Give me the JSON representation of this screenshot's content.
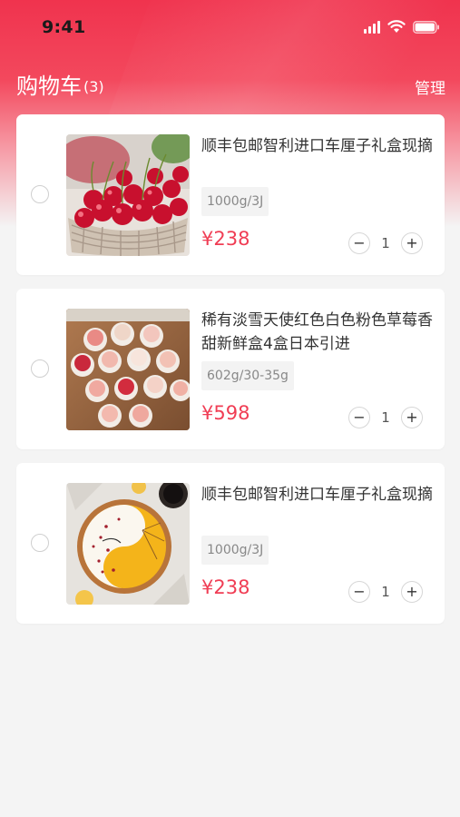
{
  "status_bar": {
    "time": "9:41"
  },
  "header": {
    "title": "购物车",
    "count": "(3)",
    "manage_label": "管理"
  },
  "cart": {
    "items": [
      {
        "name": "顺丰包邮智利进口车厘子礼盒现摘",
        "spec": "1000g/3J",
        "price": "¥238",
        "quantity": "1",
        "image": "cherries-image",
        "selected": false
      },
      {
        "name": "稀有淡雪天使红色白色粉色草莓香甜新鲜盒4盒日本引进",
        "spec": "602g/30-35g",
        "price": "¥598",
        "quantity": "1",
        "image": "strawberries-image",
        "selected": false
      },
      {
        "name": "顺丰包邮智利进口车厘子礼盒现摘",
        "spec": "1000g/3J",
        "price": "¥238",
        "quantity": "1",
        "image": "tart-image",
        "selected": false
      }
    ],
    "minus_symbol": "−",
    "plus_symbol": "+"
  },
  "colors": {
    "accent": "#f03d54",
    "header_gradient_top": "#f0334e"
  }
}
